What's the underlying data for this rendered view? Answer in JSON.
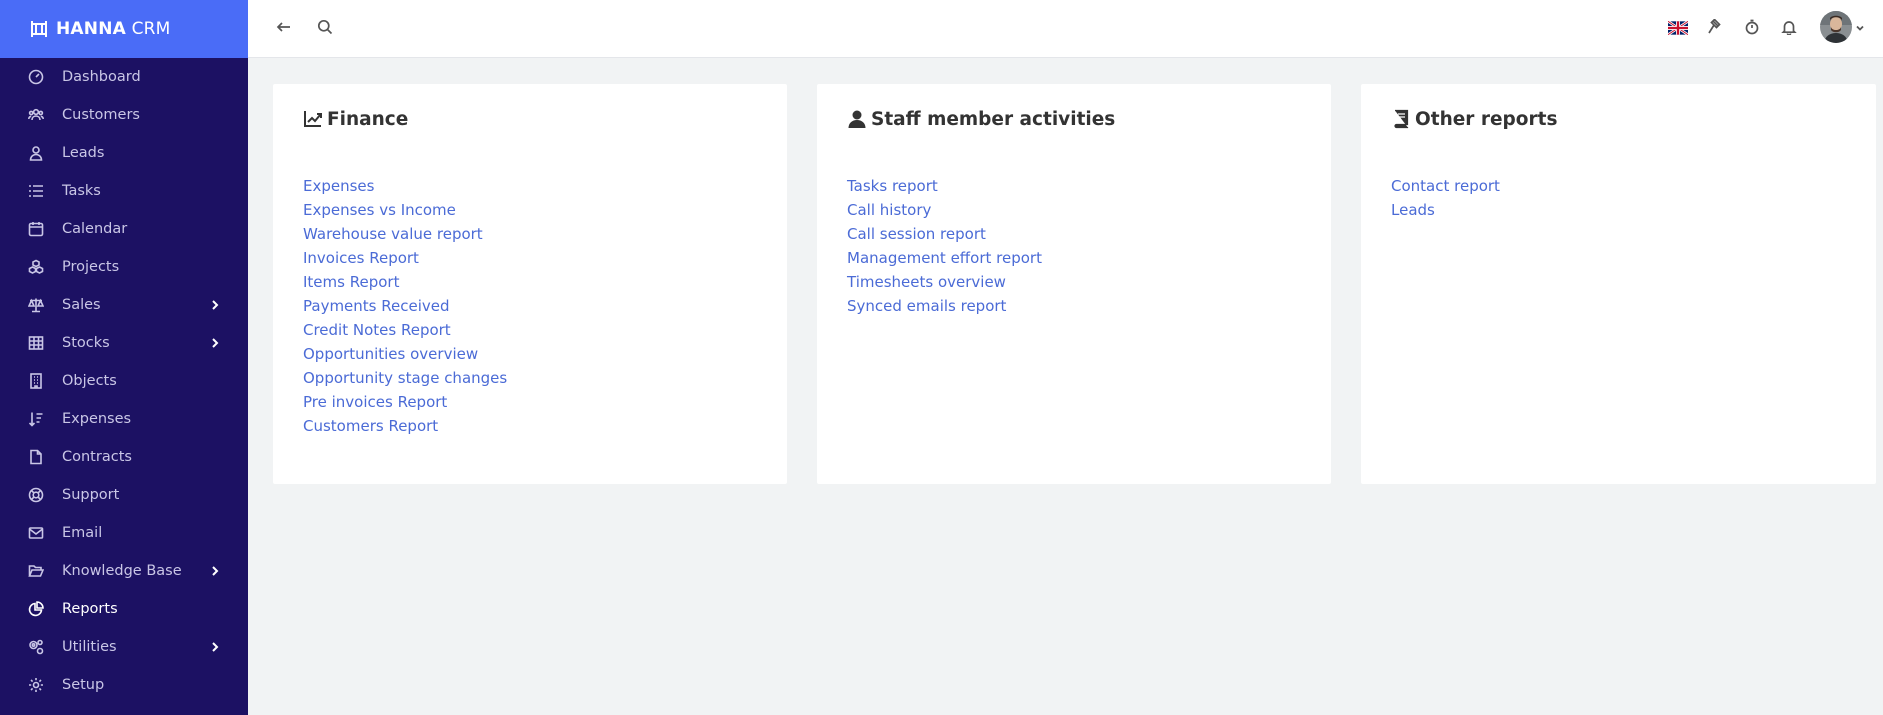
{
  "brand": {
    "name_bold": "HANNA",
    "name_light": " CRM",
    "color": "#4a6cf7",
    "sidebar_bg": "#1c1163"
  },
  "sidebar": {
    "items": [
      {
        "label": "Dashboard",
        "icon": "gauge-icon"
      },
      {
        "label": "Customers",
        "icon": "users-icon"
      },
      {
        "label": "Leads",
        "icon": "lead-icon"
      },
      {
        "label": "Tasks",
        "icon": "list-icon"
      },
      {
        "label": "Calendar",
        "icon": "calendar-icon"
      },
      {
        "label": "Projects",
        "icon": "cubes-icon"
      },
      {
        "label": "Sales",
        "icon": "scale-icon",
        "expandable": true
      },
      {
        "label": "Stocks",
        "icon": "table-icon",
        "expandable": true
      },
      {
        "label": "Objects",
        "icon": "building-icon"
      },
      {
        "label": "Expenses",
        "icon": "sort-icon"
      },
      {
        "label": "Contracts",
        "icon": "file-icon"
      },
      {
        "label": "Support",
        "icon": "lifering-icon"
      },
      {
        "label": "Email",
        "icon": "envelope-icon"
      },
      {
        "label": "Knowledge Base",
        "icon": "folder-open-icon",
        "expandable": true
      },
      {
        "label": "Reports",
        "icon": "pie-chart-icon",
        "active": true
      },
      {
        "label": "Utilities",
        "icon": "cogs-icon",
        "expandable": true
      },
      {
        "label": "Setup",
        "icon": "gear-icon"
      }
    ]
  },
  "topbar": {
    "icons": [
      "back-arrow-icon",
      "search-icon",
      "uk-flag-icon",
      "gavel-icon",
      "stopwatch-icon",
      "bell-icon",
      "avatar",
      "chevron-down-icon"
    ]
  },
  "panels": {
    "finance": {
      "title": "Finance",
      "icon": "line-chart-icon",
      "links": [
        "Expenses",
        "Expenses vs Income",
        "Warehouse value report",
        "Invoices Report",
        "Items Report",
        "Payments Received",
        "Credit Notes Report",
        "Opportunities overview",
        "Opportunity stage changes",
        "Pre invoices Report",
        "Customers Report"
      ]
    },
    "staff": {
      "title": "Staff member activities",
      "icon": "user-icon",
      "links": [
        "Tasks report",
        "Call history",
        "Call session report",
        "Management effort report",
        "Timesheets overview",
        "Synced emails report"
      ]
    },
    "other": {
      "title": "Other reports",
      "icon": "book-icon",
      "links": [
        "Contact report",
        "Leads"
      ]
    }
  },
  "colors": {
    "link": "#4b6bd6",
    "page_bg": "#f1f3f4"
  }
}
